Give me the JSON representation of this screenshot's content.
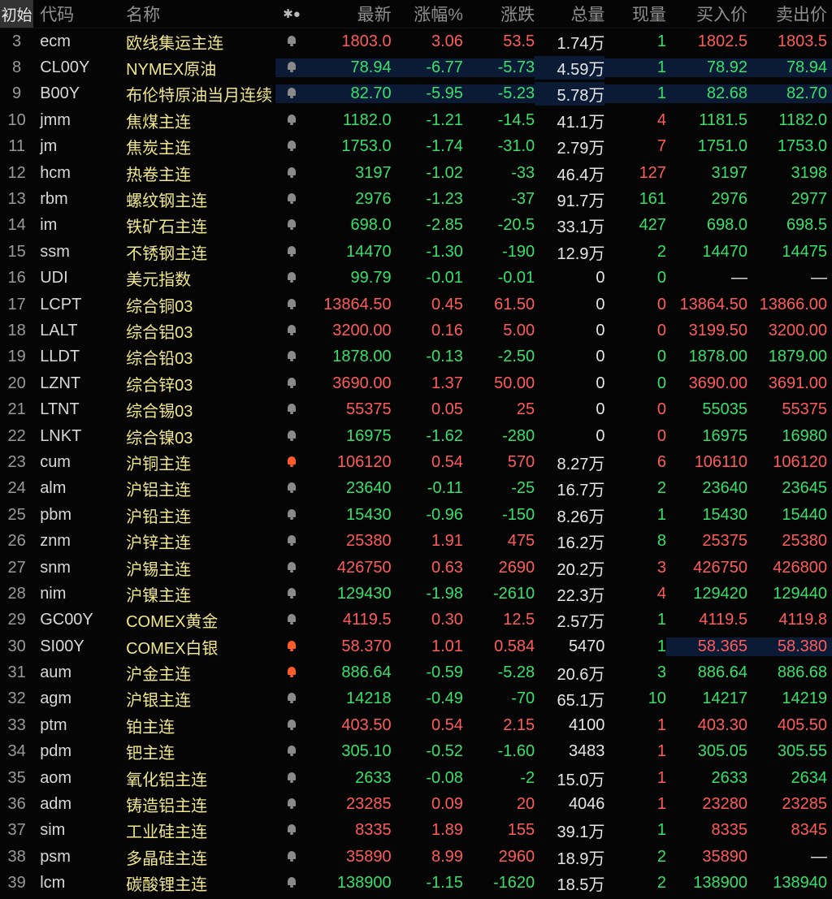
{
  "header": {
    "tab_label": "初始",
    "code": "代码",
    "name": "名称",
    "flags": "✱●",
    "last": "最新",
    "pct": "涨幅%",
    "chg": "涨跌",
    "vol": "总量",
    "cur": "现量",
    "bid": "买入价",
    "ask": "卖出价"
  },
  "rows": [
    {
      "idx": "3",
      "code": "ecm",
      "name": "欧线集运主连",
      "bell": "off",
      "last": "1803.0",
      "pct": "3.06",
      "chg": "53.5",
      "vol": "1.74万",
      "cur": "1",
      "bid": "1802.5",
      "ask": "1803.5",
      "lastc": "red",
      "pctc": "red",
      "chgc": "red",
      "curc": "green",
      "bidc": "red",
      "askc": "red"
    },
    {
      "idx": "8",
      "code": "CL00Y",
      "name": "NYMEX原油",
      "bell": "off",
      "last": "78.94",
      "pct": "-6.77",
      "chg": "-5.73",
      "vol": "4.59万",
      "cur": "1",
      "bid": "78.92",
      "ask": "78.94",
      "lastc": "green",
      "pctc": "green",
      "chgc": "green",
      "curc": "green",
      "bidc": "green",
      "askc": "green",
      "hl": "navy"
    },
    {
      "idx": "9",
      "code": "B00Y",
      "name": "布伦特原油当月连续",
      "bell": "off",
      "last": "82.70",
      "pct": "-5.95",
      "chg": "-5.23",
      "vol": "5.78万",
      "cur": "1",
      "bid": "82.68",
      "ask": "82.70",
      "lastc": "green",
      "pctc": "green",
      "chgc": "green",
      "curc": "green",
      "bidc": "green",
      "askc": "green",
      "hl": "navy"
    },
    {
      "idx": "10",
      "code": "jmm",
      "name": "焦煤主连",
      "bell": "off",
      "last": "1182.0",
      "pct": "-1.21",
      "chg": "-14.5",
      "vol": "41.1万",
      "cur": "4",
      "bid": "1181.5",
      "ask": "1182.0",
      "lastc": "green",
      "pctc": "green",
      "chgc": "green",
      "curc": "red",
      "bidc": "green",
      "askc": "green"
    },
    {
      "idx": "11",
      "code": "jm",
      "name": "焦炭主连",
      "bell": "off",
      "last": "1753.0",
      "pct": "-1.74",
      "chg": "-31.0",
      "vol": "2.79万",
      "cur": "7",
      "bid": "1751.0",
      "ask": "1753.0",
      "lastc": "green",
      "pctc": "green",
      "chgc": "green",
      "curc": "red",
      "bidc": "green",
      "askc": "green"
    },
    {
      "idx": "12",
      "code": "hcm",
      "name": "热卷主连",
      "bell": "off",
      "last": "3197",
      "pct": "-1.02",
      "chg": "-33",
      "vol": "46.4万",
      "cur": "127",
      "bid": "3197",
      "ask": "3198",
      "lastc": "green",
      "pctc": "green",
      "chgc": "green",
      "curc": "red",
      "bidc": "green",
      "askc": "green"
    },
    {
      "idx": "13",
      "code": "rbm",
      "name": "螺纹钢主连",
      "bell": "off",
      "last": "2976",
      "pct": "-1.23",
      "chg": "-37",
      "vol": "91.7万",
      "cur": "161",
      "bid": "2976",
      "ask": "2977",
      "lastc": "green",
      "pctc": "green",
      "chgc": "green",
      "curc": "green",
      "bidc": "green",
      "askc": "green"
    },
    {
      "idx": "14",
      "code": "im",
      "name": "铁矿石主连",
      "bell": "off",
      "last": "698.0",
      "pct": "-2.85",
      "chg": "-20.5",
      "vol": "33.1万",
      "cur": "427",
      "bid": "698.0",
      "ask": "698.5",
      "lastc": "green",
      "pctc": "green",
      "chgc": "green",
      "curc": "green",
      "bidc": "green",
      "askc": "green"
    },
    {
      "idx": "15",
      "code": "ssm",
      "name": "不锈钢主连",
      "bell": "off",
      "last": "14470",
      "pct": "-1.30",
      "chg": "-190",
      "vol": "12.9万",
      "cur": "2",
      "bid": "14470",
      "ask": "14475",
      "lastc": "green",
      "pctc": "green",
      "chgc": "green",
      "curc": "green",
      "bidc": "green",
      "askc": "green"
    },
    {
      "idx": "16",
      "code": "UDI",
      "name": "美元指数",
      "bell": "off",
      "last": "99.79",
      "pct": "-0.01",
      "chg": "-0.01",
      "vol": "0",
      "cur": "0",
      "bid": "—",
      "ask": "—",
      "lastc": "green",
      "pctc": "green",
      "chgc": "green",
      "curc": "green",
      "bidc": "white",
      "askc": "white"
    },
    {
      "idx": "17",
      "code": "LCPT",
      "name": "综合铜03",
      "bell": "off",
      "last": "13864.50",
      "pct": "0.45",
      "chg": "61.50",
      "vol": "0",
      "cur": "0",
      "bid": "13864.50",
      "ask": "13866.00",
      "lastc": "red",
      "pctc": "red",
      "chgc": "red",
      "curc": "red",
      "bidc": "red",
      "askc": "red"
    },
    {
      "idx": "18",
      "code": "LALT",
      "name": "综合铝03",
      "bell": "off",
      "last": "3200.00",
      "pct": "0.16",
      "chg": "5.00",
      "vol": "0",
      "cur": "0",
      "bid": "3199.50",
      "ask": "3200.00",
      "lastc": "red",
      "pctc": "red",
      "chgc": "red",
      "curc": "red",
      "bidc": "red",
      "askc": "red"
    },
    {
      "idx": "19",
      "code": "LLDT",
      "name": "综合铅03",
      "bell": "off",
      "last": "1878.00",
      "pct": "-0.13",
      "chg": "-2.50",
      "vol": "0",
      "cur": "0",
      "bid": "1878.00",
      "ask": "1879.00",
      "lastc": "green",
      "pctc": "green",
      "chgc": "green",
      "curc": "green",
      "bidc": "green",
      "askc": "green"
    },
    {
      "idx": "20",
      "code": "LZNT",
      "name": "综合锌03",
      "bell": "off",
      "last": "3690.00",
      "pct": "1.37",
      "chg": "50.00",
      "vol": "0",
      "cur": "0",
      "bid": "3690.00",
      "ask": "3691.00",
      "lastc": "red",
      "pctc": "red",
      "chgc": "red",
      "curc": "green",
      "bidc": "red",
      "askc": "red"
    },
    {
      "idx": "21",
      "code": "LTNT",
      "name": "综合锡03",
      "bell": "off",
      "last": "55375",
      "pct": "0.05",
      "chg": "25",
      "vol": "0",
      "cur": "0",
      "bid": "55035",
      "ask": "55375",
      "lastc": "red",
      "pctc": "red",
      "chgc": "red",
      "curc": "red",
      "bidc": "green",
      "askc": "red"
    },
    {
      "idx": "22",
      "code": "LNKT",
      "name": "综合镍03",
      "bell": "off",
      "last": "16975",
      "pct": "-1.62",
      "chg": "-280",
      "vol": "0",
      "cur": "0",
      "bid": "16975",
      "ask": "16980",
      "lastc": "green",
      "pctc": "green",
      "chgc": "green",
      "curc": "red",
      "bidc": "green",
      "askc": "green"
    },
    {
      "idx": "23",
      "code": "cum",
      "name": "沪铜主连",
      "bell": "on",
      "last": "106120",
      "pct": "0.54",
      "chg": "570",
      "vol": "8.27万",
      "cur": "6",
      "bid": "106110",
      "ask": "106120",
      "lastc": "red",
      "pctc": "red",
      "chgc": "red",
      "curc": "red",
      "bidc": "red",
      "askc": "red"
    },
    {
      "idx": "24",
      "code": "alm",
      "name": "沪铝主连",
      "bell": "off",
      "last": "23640",
      "pct": "-0.11",
      "chg": "-25",
      "vol": "16.7万",
      "cur": "2",
      "bid": "23640",
      "ask": "23645",
      "lastc": "green",
      "pctc": "green",
      "chgc": "green",
      "curc": "green",
      "bidc": "green",
      "askc": "green"
    },
    {
      "idx": "25",
      "code": "pbm",
      "name": "沪铅主连",
      "bell": "off",
      "last": "15430",
      "pct": "-0.96",
      "chg": "-150",
      "vol": "8.26万",
      "cur": "1",
      "bid": "15430",
      "ask": "15440",
      "lastc": "green",
      "pctc": "green",
      "chgc": "green",
      "curc": "green",
      "bidc": "green",
      "askc": "green"
    },
    {
      "idx": "26",
      "code": "znm",
      "name": "沪锌主连",
      "bell": "off",
      "last": "25380",
      "pct": "1.91",
      "chg": "475",
      "vol": "16.2万",
      "cur": "8",
      "bid": "25375",
      "ask": "25380",
      "lastc": "red",
      "pctc": "red",
      "chgc": "red",
      "curc": "green",
      "bidc": "red",
      "askc": "red"
    },
    {
      "idx": "27",
      "code": "snm",
      "name": "沪锡主连",
      "bell": "off",
      "last": "426750",
      "pct": "0.63",
      "chg": "2690",
      "vol": "20.2万",
      "cur": "3",
      "bid": "426750",
      "ask": "426800",
      "lastc": "red",
      "pctc": "red",
      "chgc": "red",
      "curc": "red",
      "bidc": "red",
      "askc": "red"
    },
    {
      "idx": "28",
      "code": "nim",
      "name": "沪镍主连",
      "bell": "off",
      "last": "129430",
      "pct": "-1.98",
      "chg": "-2610",
      "vol": "22.3万",
      "cur": "4",
      "bid": "129420",
      "ask": "129440",
      "lastc": "green",
      "pctc": "green",
      "chgc": "green",
      "curc": "red",
      "bidc": "green",
      "askc": "green"
    },
    {
      "idx": "29",
      "code": "GC00Y",
      "name": "COMEX黄金",
      "bell": "off",
      "last": "4119.5",
      "pct": "0.30",
      "chg": "12.5",
      "vol": "2.57万",
      "cur": "1",
      "bid": "4119.5",
      "ask": "4119.8",
      "lastc": "red",
      "pctc": "red",
      "chgc": "red",
      "curc": "green",
      "bidc": "red",
      "askc": "red"
    },
    {
      "idx": "30",
      "code": "SI00Y",
      "name": "COMEX白银",
      "bell": "on",
      "last": "58.370",
      "pct": "1.01",
      "chg": "0.584",
      "vol": "5470",
      "cur": "1",
      "bid": "58.365",
      "ask": "58.380",
      "lastc": "red",
      "pctc": "red",
      "chgc": "red",
      "curc": "green",
      "bidc": "red",
      "askc": "red",
      "hl_bid": "navy"
    },
    {
      "idx": "31",
      "code": "aum",
      "name": "沪金主连",
      "bell": "on",
      "last": "886.64",
      "pct": "-0.59",
      "chg": "-5.28",
      "vol": "20.6万",
      "cur": "3",
      "bid": "886.64",
      "ask": "886.68",
      "lastc": "green",
      "pctc": "green",
      "chgc": "green",
      "curc": "green",
      "bidc": "green",
      "askc": "green"
    },
    {
      "idx": "32",
      "code": "agm",
      "name": "沪银主连",
      "bell": "off",
      "last": "14218",
      "pct": "-0.49",
      "chg": "-70",
      "vol": "65.1万",
      "cur": "10",
      "bid": "14217",
      "ask": "14219",
      "lastc": "green",
      "pctc": "green",
      "chgc": "green",
      "curc": "green",
      "bidc": "green",
      "askc": "green"
    },
    {
      "idx": "33",
      "code": "ptm",
      "name": "铂主连",
      "bell": "off",
      "last": "403.50",
      "pct": "0.54",
      "chg": "2.15",
      "vol": "4100",
      "cur": "1",
      "bid": "403.30",
      "ask": "405.50",
      "lastc": "red",
      "pctc": "red",
      "chgc": "red",
      "curc": "red",
      "bidc": "red",
      "askc": "red"
    },
    {
      "idx": "34",
      "code": "pdm",
      "name": "钯主连",
      "bell": "off",
      "last": "305.10",
      "pct": "-0.52",
      "chg": "-1.60",
      "vol": "3483",
      "cur": "1",
      "bid": "305.05",
      "ask": "305.55",
      "lastc": "green",
      "pctc": "green",
      "chgc": "green",
      "curc": "red",
      "bidc": "green",
      "askc": "green"
    },
    {
      "idx": "35",
      "code": "aom",
      "name": "氧化铝主连",
      "bell": "off",
      "last": "2633",
      "pct": "-0.08",
      "chg": "-2",
      "vol": "15.0万",
      "cur": "1",
      "bid": "2633",
      "ask": "2634",
      "lastc": "green",
      "pctc": "green",
      "chgc": "green",
      "curc": "red",
      "bidc": "green",
      "askc": "green"
    },
    {
      "idx": "36",
      "code": "adm",
      "name": "铸造铝主连",
      "bell": "off",
      "last": "23285",
      "pct": "0.09",
      "chg": "20",
      "vol": "4046",
      "cur": "1",
      "bid": "23280",
      "ask": "23285",
      "lastc": "red",
      "pctc": "red",
      "chgc": "red",
      "curc": "red",
      "bidc": "red",
      "askc": "red"
    },
    {
      "idx": "37",
      "code": "sim",
      "name": "工业硅主连",
      "bell": "off",
      "last": "8335",
      "pct": "1.89",
      "chg": "155",
      "vol": "39.1万",
      "cur": "1",
      "bid": "8335",
      "ask": "8345",
      "lastc": "red",
      "pctc": "red",
      "chgc": "red",
      "curc": "green",
      "bidc": "red",
      "askc": "red"
    },
    {
      "idx": "38",
      "code": "psm",
      "name": "多晶硅主连",
      "bell": "off",
      "last": "35890",
      "pct": "8.99",
      "chg": "2960",
      "vol": "18.9万",
      "cur": "2",
      "bid": "35890",
      "ask": "—",
      "lastc": "red",
      "pctc": "red",
      "chgc": "red",
      "curc": "green",
      "bidc": "red",
      "askc": "white"
    },
    {
      "idx": "39",
      "code": "lcm",
      "name": "碳酸锂主连",
      "bell": "off",
      "last": "138900",
      "pct": "-1.15",
      "chg": "-1620",
      "vol": "18.5万",
      "cur": "2",
      "bid": "138900",
      "ask": "138940",
      "lastc": "green",
      "pctc": "green",
      "chgc": "green",
      "curc": "green",
      "bidc": "green",
      "askc": "green"
    }
  ]
}
